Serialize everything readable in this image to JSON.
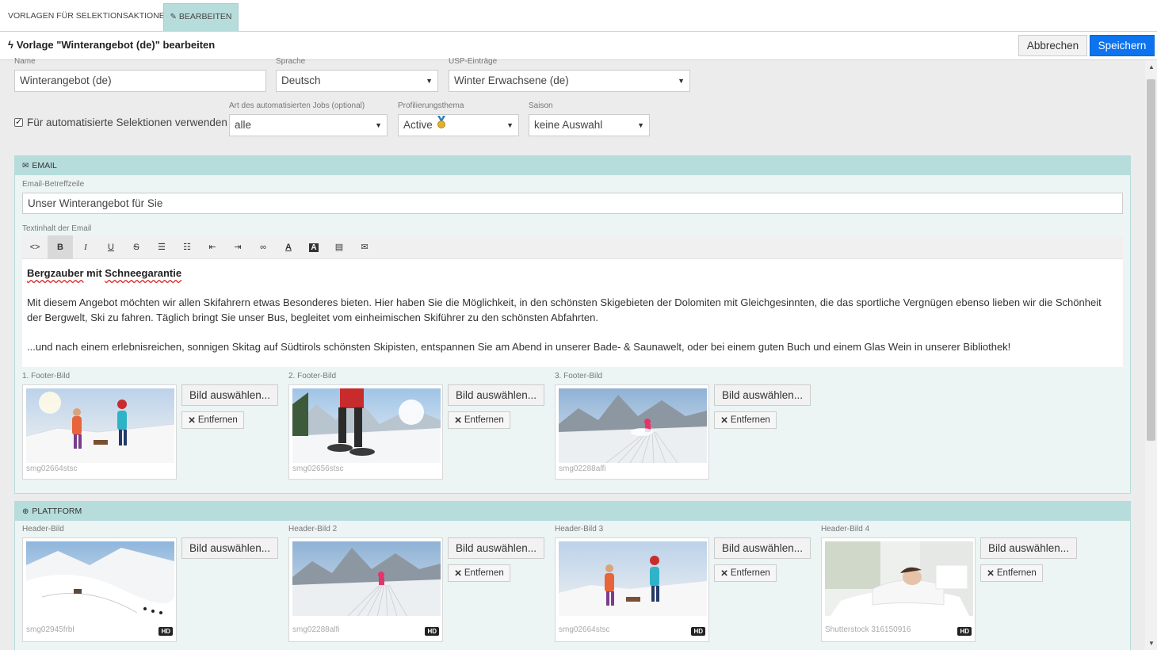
{
  "tabs": [
    {
      "label": "Vorlagen für Selektionsaktionen"
    },
    {
      "label": "Bearbeiten"
    }
  ],
  "header": {
    "title": "Vorlage \"Winterangebot (de)\" bearbeiten",
    "cancel_label": "Abbrechen",
    "save_label": "Speichern"
  },
  "form": {
    "name_label": "Name",
    "name_value": "Winterangebot (de)",
    "language_label": "Sprache",
    "language_value": "Deutsch",
    "usp_label": "USP-Einträge",
    "usp_value": "Winter Erwachsene (de)",
    "auto_checkbox_label": "Für automatisierte Selektionen verwenden",
    "auto_checkbox_checked": true,
    "job_type_label": "Art des automatisierten Jobs (optional)",
    "job_type_value": "alle",
    "profile_label": "Profilierungsthema",
    "profile_value": "Active",
    "season_label": "Saison",
    "season_value": "keine Auswahl"
  },
  "email": {
    "section_title": "Email",
    "subject_label": "Email-Betreffzeile",
    "subject_value": "Unser Winterangebot für Sie",
    "body_label": "Textinhalt der Email",
    "body": {
      "headline_word1": "Bergzauber",
      "headline_word2": "mit",
      "headline_word3": "Schneegarantie",
      "paragraph1": "Mit diesem Angebot möchten wir allen Skifahrern etwas Besonderes bieten. Hier haben Sie die Möglichkeit, in den schönsten Skigebieten der Dolomiten mit Gleichgesinnten, die das sportliche Vergnügen ebenso lieben wir die Schönheit der Bergwelt, Ski zu fahren. Täglich bringt Sie unser Bus, begleitet vom einheimischen Skiführer zu den schönsten Abfahrten.",
      "paragraph2": "...und nach einem erlebnisreichen, sonnigen Skitag auf Südtirols schönsten Skipisten, entspannen Sie am Abend in unserer Bade- & Saunawelt, oder bei einem guten Buch und einem Glas Wein in unserer Bibliothek!"
    },
    "footer_images": [
      {
        "label": "1. Footer-Bild",
        "caption": "smg02664stsc"
      },
      {
        "label": "2. Footer-Bild",
        "caption": "smg02656stsc"
      },
      {
        "label": "3. Footer-Bild",
        "caption": "smg02288alfi"
      }
    ]
  },
  "platform": {
    "section_title": "Plattform",
    "header_images": [
      {
        "label": "Header-Bild",
        "caption": "smg02945frbl",
        "badge": "HD"
      },
      {
        "label": "Header-Bild 2",
        "caption": "smg02288alfi",
        "badge": "HD"
      },
      {
        "label": "Header-Bild 3",
        "caption": "smg02664stsc",
        "badge": "HD"
      },
      {
        "label": "Header-Bild 4",
        "caption": "Shutterstock 316150916",
        "badge": "HD"
      }
    ]
  },
  "buttons": {
    "pick_image": "Bild auswählen...",
    "remove": "Entfernen"
  },
  "icons": {
    "toolbar": [
      "code-icon",
      "bold-icon",
      "italic-icon",
      "underline-icon",
      "strikethrough-icon",
      "unordered-list-icon",
      "ordered-list-icon",
      "outdent-icon",
      "indent-icon",
      "link-icon",
      "font-color-icon",
      "background-color-icon",
      "align-block-icon",
      "email-icon"
    ]
  },
  "colors": {
    "accent": "#0d73ee",
    "panel_header": "#b7dcdc",
    "active_tab": "#b7dcdc"
  }
}
